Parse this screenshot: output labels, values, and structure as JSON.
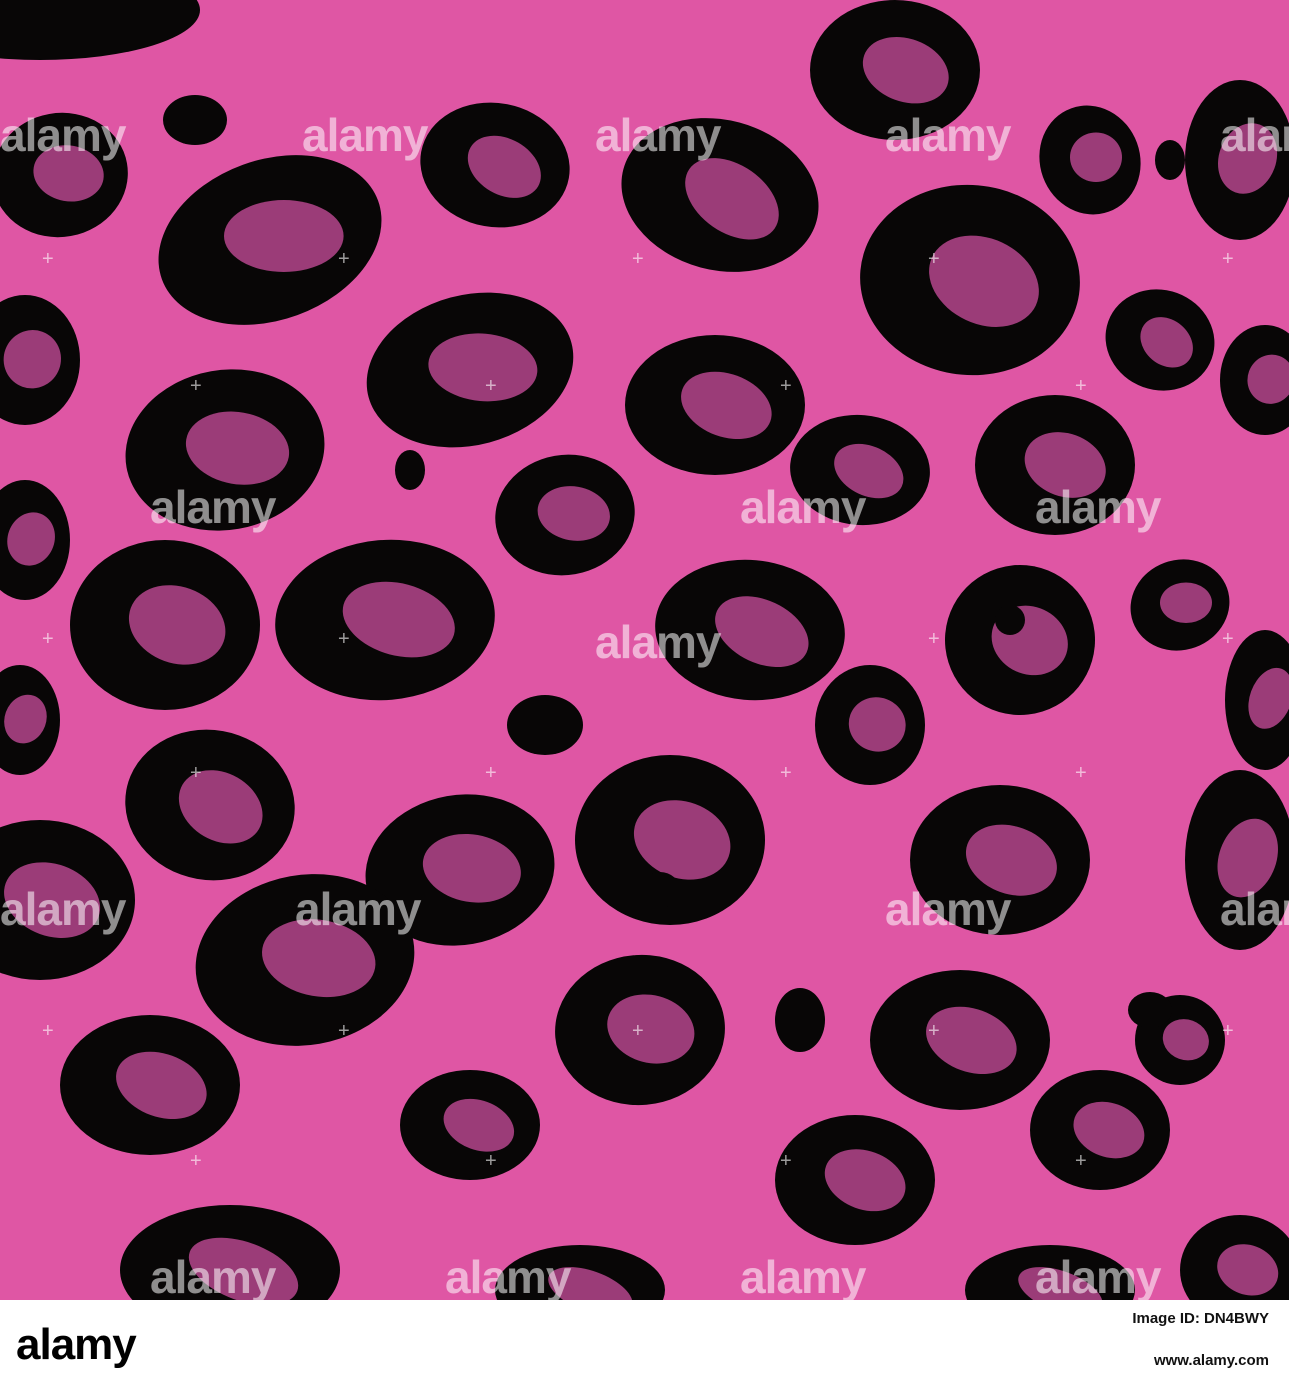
{
  "colors": {
    "background": "#df56a4",
    "spot_outer": "#080606",
    "spot_inner": "#9b3c78",
    "watermark": "#ffffff"
  },
  "watermark_text": "alamy",
  "footer": {
    "brand": "alamy",
    "image_id": "Image ID: DN4BWY",
    "site": "www.alamy.com"
  }
}
